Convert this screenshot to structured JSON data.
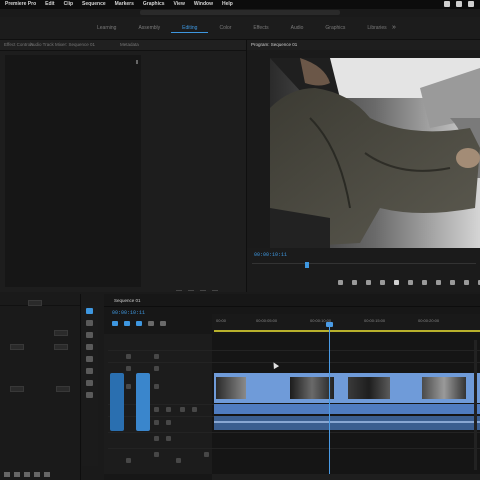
{
  "menubar": {
    "items": [
      "Premiere Pro",
      "Edit",
      "Clip",
      "Sequence",
      "Markers",
      "Graphics",
      "View",
      "Window",
      "Help"
    ]
  },
  "workspaces": {
    "tabs": [
      "Learning",
      "Assembly",
      "Editing",
      "Color",
      "Effects",
      "Audio",
      "Graphics",
      "Libraries"
    ],
    "active_index": 2,
    "more_label": "»"
  },
  "source": {
    "tabs": [
      "Effect Controls",
      "Audio Track Mixer: Sequence 01",
      "Metadata"
    ]
  },
  "program": {
    "tab_label": "Program: Sequence 01",
    "timecode": "00:00:10:11"
  },
  "timeline": {
    "tab_label": "Sequence 01",
    "timecode": "00:00:10:11",
    "ruler_ticks": [
      "00:00",
      "00:00:05:00",
      "00:00:10:00",
      "00:00:15:00",
      "00:00:20:00",
      "00:00:25:00"
    ]
  },
  "colors": {
    "accent": "#3e97e0",
    "work_area": "#b8b12c",
    "clip_video": "#6f9bd9",
    "clip_audio": "#3b5e8f"
  }
}
